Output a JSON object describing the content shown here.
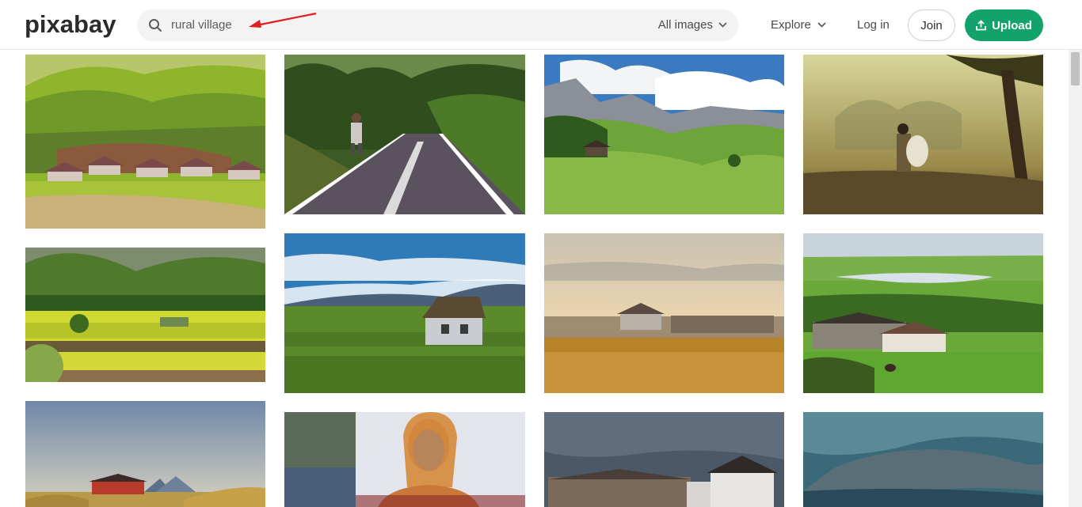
{
  "header": {
    "logo_text": "pixabay",
    "search": {
      "value": "rural village",
      "filter_label": "All images"
    },
    "nav": {
      "explore_label": "Explore",
      "login_label": "Log in",
      "join_label": "Join",
      "upload_label": "Upload"
    }
  },
  "colors": {
    "brand_green": "#13a26b",
    "annotation_arrow": "#e02020"
  },
  "gallery": {
    "images": [
      {
        "subject": "hillside-cottages"
      },
      {
        "subject": "forest-road-walker"
      },
      {
        "subject": "alpine-meadow-hut"
      },
      {
        "subject": "misty-field-walker"
      },
      {
        "subject": "green-valley-field"
      },
      {
        "subject": "field-stone-house"
      },
      {
        "subject": "golden-field-farmhouses"
      },
      {
        "subject": "river-valley-village"
      },
      {
        "subject": "red-farmhouse-dusk"
      },
      {
        "subject": "woman-portrait"
      },
      {
        "subject": "stormy-village"
      },
      {
        "subject": "stormy-sky-sea"
      }
    ]
  }
}
